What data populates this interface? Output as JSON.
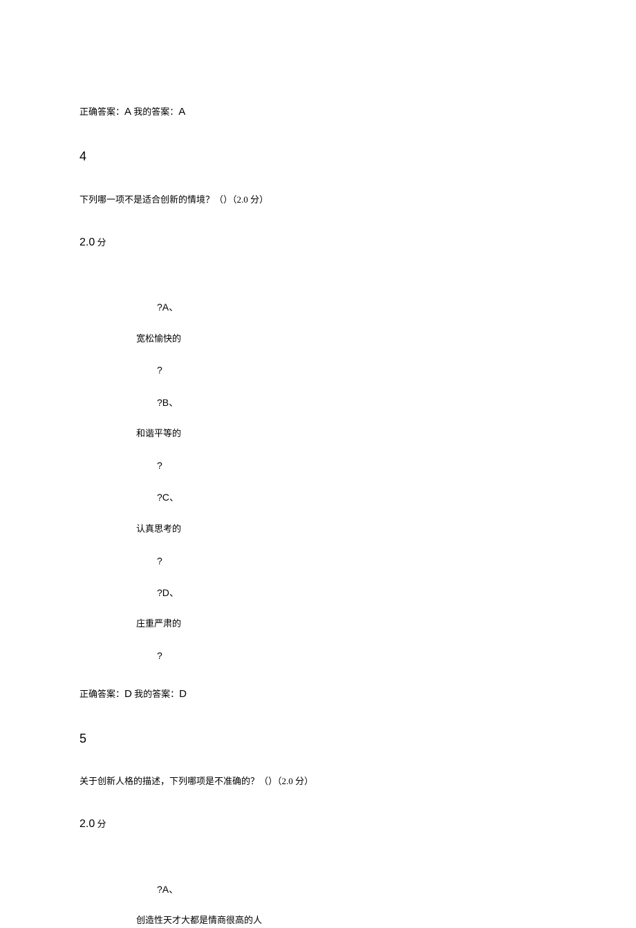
{
  "answer3": {
    "correct_label": "正确答案：",
    "correct_value": "A",
    "my_label": " 我的答案：",
    "my_value": "A"
  },
  "question4": {
    "number": "4",
    "text": "下列哪一项不是适合创新的情境？（）（2.0 分）",
    "score": "2.0",
    "score_suffix": " 分",
    "options": {
      "a_label": "?A、",
      "a_text": "宽松愉快的",
      "b_label": "?B、",
      "b_text": "和谐平等的",
      "c_label": "?C、",
      "c_text": "认真思考的",
      "d_label": "?D、",
      "d_text": "庄重严肃的"
    },
    "qmark": "?",
    "answer": {
      "correct_label": "正确答案：",
      "correct_value": "D",
      "my_label": " 我的答案：",
      "my_value": "D"
    }
  },
  "question5": {
    "number": "5",
    "text": "关于创新人格的描述，下列哪项是不准确的？（）（2.0 分）",
    "score": "2.0",
    "score_suffix": " 分",
    "options": {
      "a_label": "?A、",
      "a_text": "创造性天才大都是情商很高的人"
    }
  }
}
